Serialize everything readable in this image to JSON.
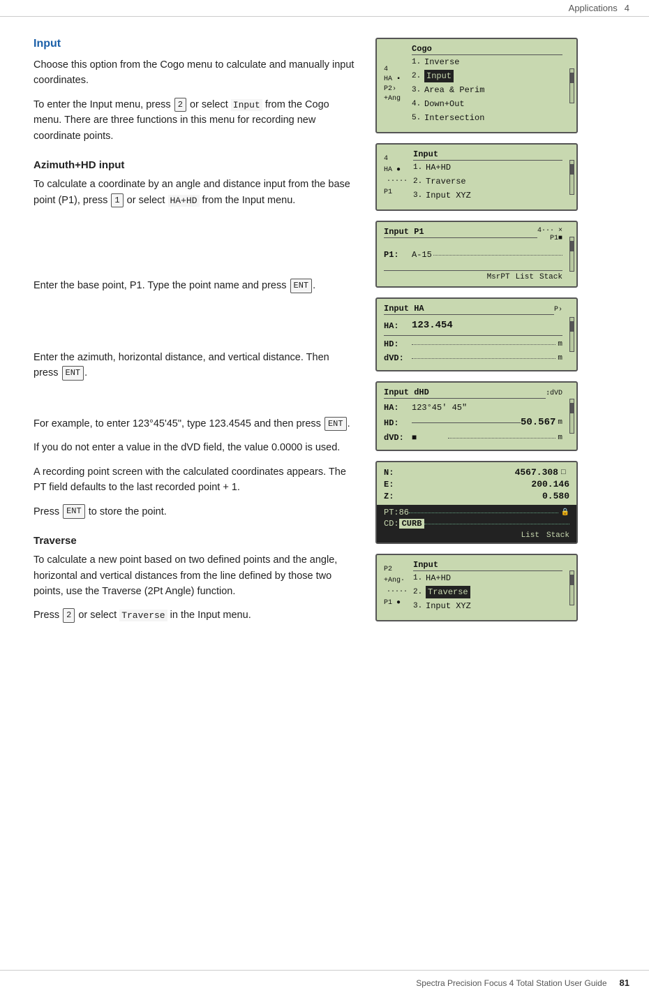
{
  "header": {
    "chapter": "Applications",
    "chapter_num": "4",
    "page": "81"
  },
  "sections": {
    "input": {
      "heading": "Input",
      "intro": "Choose this option from the Cogo menu to calculate and manually input coordinates.",
      "para1": "To enter the Input menu, press",
      "key1": "2",
      "para1b": "or select",
      "code1": "Input",
      "para1c": "from the Cogo menu. There are three functions in this menu for recording new coordinate points."
    },
    "azimuth": {
      "heading": "Azimuth+HD input",
      "para1": "To calculate a coordinate by an angle and distance input from the base point (P1), press",
      "key1": "1",
      "para1b": "or select",
      "code1": "HA+HD",
      "para1c": "from the Input menu.",
      "para2": "Enter the base point, P1. Type the point name and press",
      "key2": "ENT",
      "para2c": ".",
      "para3": "Enter the azimuth, horizontal distance, and vertical distance. Then press",
      "key3": "ENT",
      "para3c": ".",
      "para4": "For example, to enter 123°45'45\", type 123.4545 and then press",
      "key4": "ENT",
      "para4c": ".",
      "para5": "If you do not enter a value in the dVD field, the value 0.0000 is used.",
      "para6": "A recording point screen with the calculated coordinates appears. The PT field defaults to the last recorded point + 1.",
      "para7": "Press",
      "key7": "ENT",
      "para7c": "to store the point."
    },
    "traverse": {
      "heading": "Traverse",
      "para1": "To calculate a new point based on two defined points and the angle, horizontal and vertical distances from the line defined by those two points, use the Traverse (2Pt Angle) function.",
      "para2": "Press",
      "key2": "2",
      "para2b": "or select",
      "code2": "Traverse",
      "para2c": "in the Input menu."
    }
  },
  "screens": {
    "cogo_menu": {
      "title": "Cogo",
      "items": [
        {
          "num": "1.",
          "label": "Inverse",
          "selected": false
        },
        {
          "num": "2.",
          "label": "Input",
          "selected": true
        },
        {
          "num": "3.",
          "label": "Area & Perim",
          "selected": false
        },
        {
          "num": "4.",
          "label": "Down+Out",
          "selected": false
        },
        {
          "num": "5.",
          "label": "Intersection",
          "selected": false
        }
      ],
      "side_labels": [
        "4",
        "HA",
        "P2",
        "+Ang"
      ]
    },
    "input_menu": {
      "title": "Input",
      "items": [
        {
          "num": "1.",
          "label": "HA+HD",
          "selected": false
        },
        {
          "num": "2.",
          "label": "Traverse",
          "selected": false
        },
        {
          "num": "3.",
          "label": "Input XYZ",
          "selected": false
        }
      ],
      "side_labels": [
        "4",
        "HA",
        "P1"
      ]
    },
    "input_p1": {
      "title": "Input P1",
      "fields": [
        {
          "label": "P1:",
          "value": "A-15",
          "dotted": true
        }
      ],
      "softkeys": [
        "MsrPT",
        "List",
        "Stack"
      ]
    },
    "input_ha": {
      "title": "Input HA",
      "fields": [
        {
          "label": "HA:",
          "value": "123.454",
          "large": true,
          "unit": ""
        },
        {
          "label": "HD:",
          "value": "",
          "unit": "m"
        },
        {
          "label": "dVD:",
          "value": "",
          "unit": "m"
        }
      ]
    },
    "input_dhd": {
      "title": "Input dHD",
      "fields": [
        {
          "label": "HA:",
          "value": "123°45' 45\"",
          "large": false,
          "unit": ""
        },
        {
          "label": "HD:",
          "value": "50.567",
          "large": true,
          "unit": "m"
        },
        {
          "label": "dVD:",
          "value": "",
          "unit": "m"
        }
      ]
    },
    "result_coords": {
      "coords": [
        {
          "label": "N:",
          "value": "4567.308"
        },
        {
          "label": "E:",
          "value": "200.146"
        },
        {
          "label": "Z:",
          "value": "0.580"
        }
      ],
      "pt_label": "PT:",
      "pt_value": "86",
      "cd_label": "CD:",
      "cd_value": "CURB",
      "softkeys": [
        "List",
        "Stack"
      ]
    },
    "traverse_menu": {
      "title": "Input",
      "items": [
        {
          "num": "1.",
          "label": "HA+HD",
          "selected": false
        },
        {
          "num": "2.",
          "label": "Traverse",
          "selected": true
        },
        {
          "num": "3.",
          "label": "Input XYZ",
          "selected": false
        }
      ],
      "side_labels": [
        "P2",
        "+Ang",
        "P1"
      ]
    }
  },
  "footer": {
    "text": "Spectra Precision Focus 4 Total Station User Guide",
    "page": "81"
  }
}
